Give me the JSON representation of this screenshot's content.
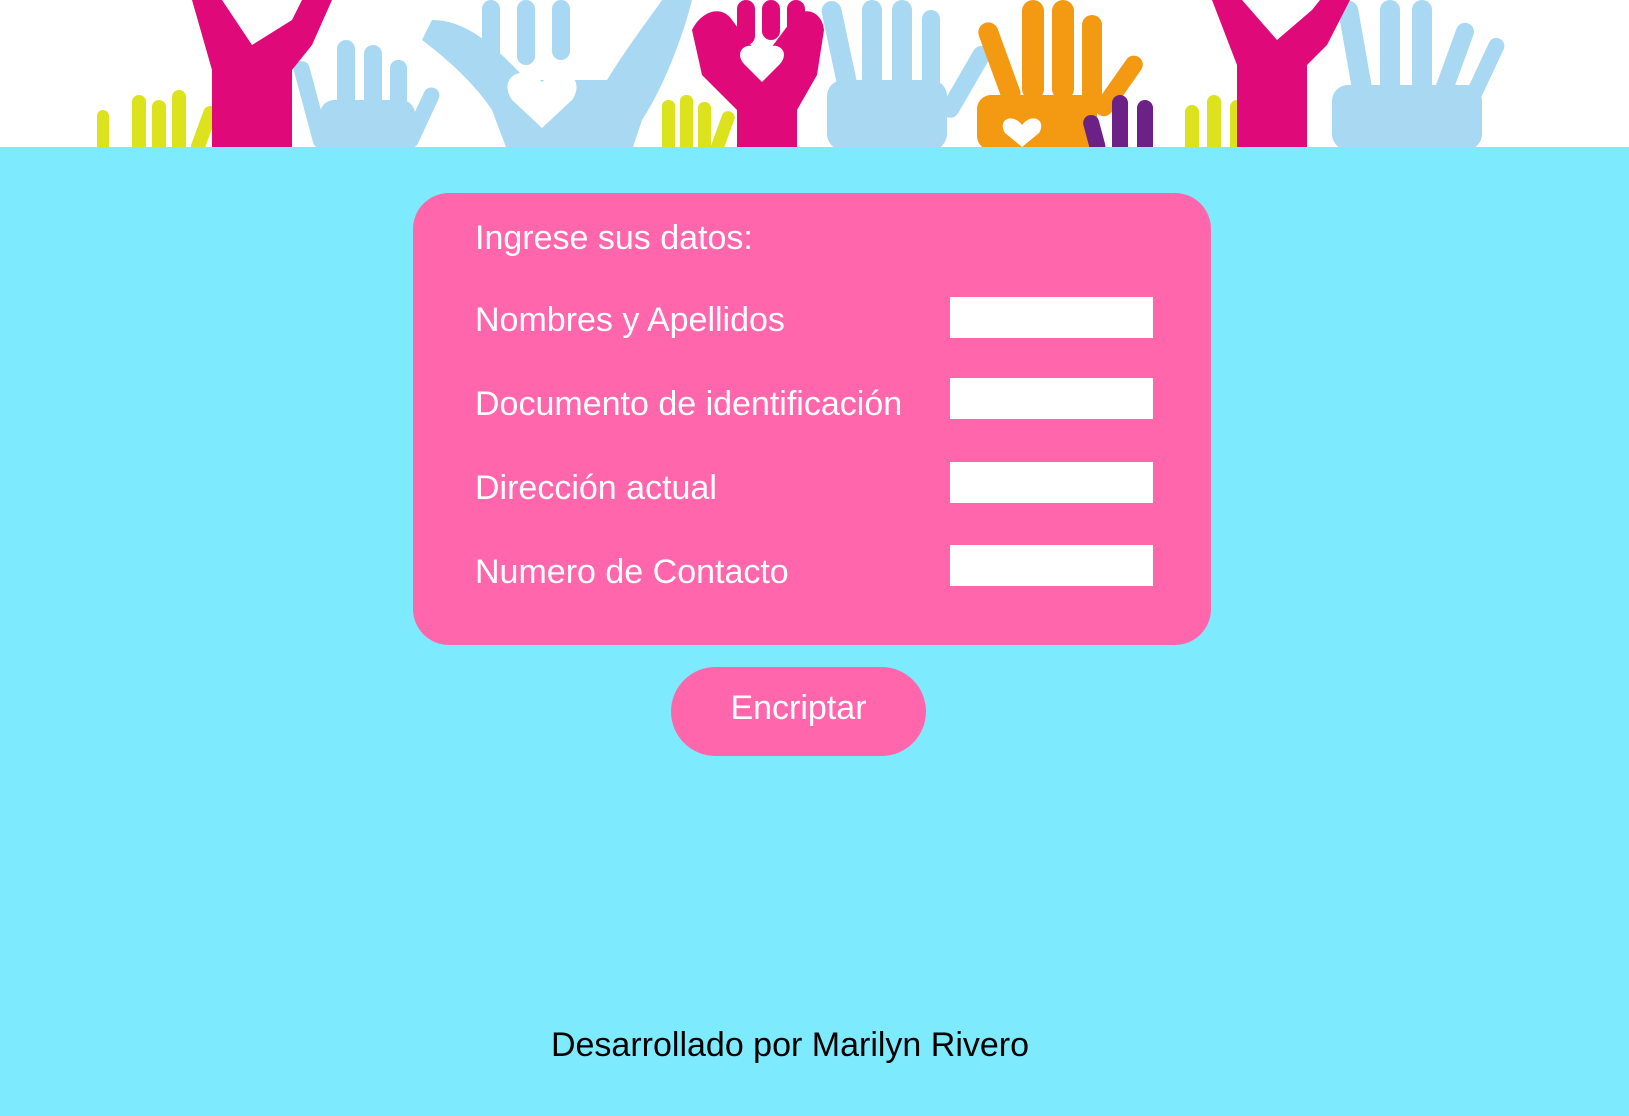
{
  "colors": {
    "background": "#7eeafd",
    "card": "#ff66ab",
    "input": "#ffffff",
    "button": "#ff66ab",
    "text_light": "#ffffff",
    "text_dark": "#000000",
    "hand_magenta": "#e0097a",
    "hand_light_blue": "#a8d8f2",
    "hand_orange": "#f39a12",
    "hand_yellow": "#dce21c",
    "hand_purple": "#6b2185"
  },
  "banner": {
    "image": "raised-hands-with-hearts-illustration"
  },
  "form": {
    "heading": "Ingrese sus datos:",
    "fields": [
      {
        "label": "Nombres y Apellidos",
        "value": "",
        "placeholder": ""
      },
      {
        "label": "Documento de identificación",
        "value": "",
        "placeholder": ""
      },
      {
        "label": "Dirección actual",
        "value": "",
        "placeholder": ""
      },
      {
        "label": "Numero de Contacto",
        "value": "",
        "placeholder": ""
      }
    ]
  },
  "button": {
    "label": "Encriptar"
  },
  "footer": {
    "credit": "Desarrollado por Marilyn Rivero"
  }
}
